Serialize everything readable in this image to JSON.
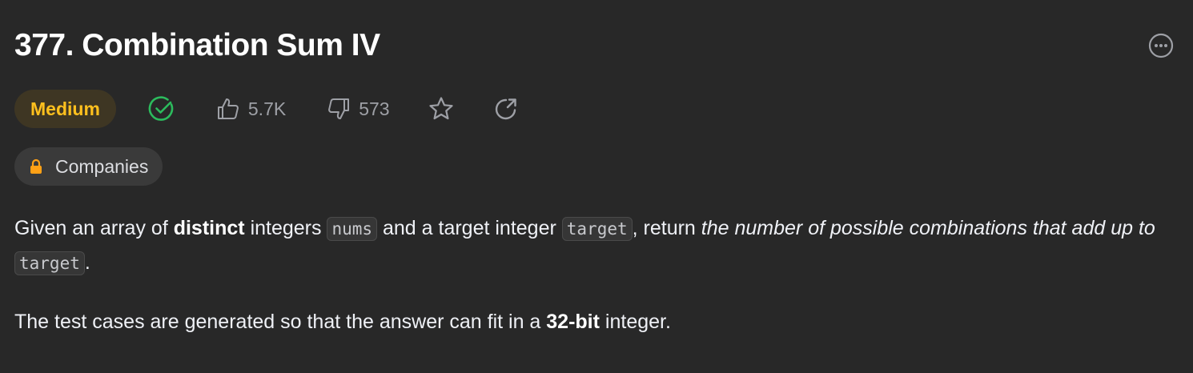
{
  "problem": {
    "title": "377. Combination Sum IV",
    "difficulty": "Medium",
    "likes": "5.7K",
    "dislikes": "573",
    "companies_label": "Companies"
  },
  "colors": {
    "background": "#282828",
    "difficulty_medium": "#ffc01e",
    "solved_green": "#2cbb5d",
    "lock_orange": "#ffa116"
  },
  "icons": {
    "more": "more-horizontal-circle-icon",
    "solved": "check-circle-icon",
    "like": "thumbs-up-icon",
    "dislike": "thumbs-down-icon",
    "favorite": "star-icon",
    "share": "share-arrow-icon",
    "lock": "lock-icon"
  },
  "description": {
    "p1": {
      "t1": "Given an array of ",
      "b1": "distinct",
      "t2": " integers ",
      "c1": "nums",
      "t3": " and a target integer ",
      "c2": "target",
      "t4": ", return ",
      "i1": "the number of possible combinations that add up to",
      "t5": " ",
      "c3": "target",
      "t6": "."
    },
    "p2": {
      "t1": "The test cases are generated so that the answer can fit in a ",
      "b1": "32-bit",
      "t2": " integer."
    }
  }
}
